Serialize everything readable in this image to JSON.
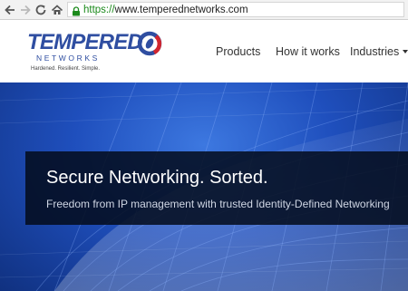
{
  "browser": {
    "url_protocol": "https://",
    "url_rest": "www.temperednetworks.com"
  },
  "header": {
    "logo": {
      "wordmark": "TEMPERED",
      "subword": "NETWORKS",
      "tagline": "Hardened. Resilient. Simple."
    },
    "nav": {
      "products": "Products",
      "how_it_works": "How it works",
      "industries": "Industries"
    }
  },
  "hero": {
    "title": "Secure Networking. Sorted.",
    "subtitle": "Freedom from IP management with trusted Identity-Defined Networking"
  },
  "colors": {
    "brand_blue": "#2f4ea1",
    "brand_red": "#d2262f",
    "hero_blue": "#1f4fbd",
    "https_green": "#1b8a1b"
  },
  "icons": [
    "back-arrow-icon",
    "forward-arrow-icon",
    "reload-icon",
    "home-icon",
    "lock-icon",
    "chevron-down-icon"
  ]
}
